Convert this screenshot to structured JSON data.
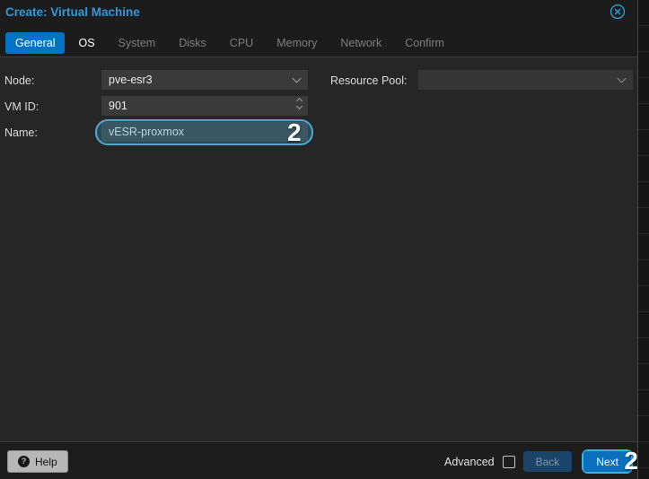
{
  "window": {
    "title": "Create: Virtual Machine"
  },
  "tabs": {
    "items": [
      {
        "label": "General",
        "state": "active"
      },
      {
        "label": "OS",
        "state": "enabled"
      },
      {
        "label": "System",
        "state": "disabled"
      },
      {
        "label": "Disks",
        "state": "disabled"
      },
      {
        "label": "CPU",
        "state": "disabled"
      },
      {
        "label": "Memory",
        "state": "disabled"
      },
      {
        "label": "Network",
        "state": "disabled"
      },
      {
        "label": "Confirm",
        "state": "disabled"
      }
    ]
  },
  "form": {
    "node": {
      "label": "Node:",
      "value": "pve-esr3",
      "control": "dropdown"
    },
    "vmid": {
      "label": "VM ID:",
      "value": "901",
      "control": "spinner"
    },
    "name": {
      "label": "Name:",
      "value": "vESR-proxmox",
      "control": "text-input"
    },
    "resource_pool": {
      "label": "Resource Pool:",
      "value": "",
      "control": "dropdown"
    }
  },
  "footer": {
    "help_label": "Help",
    "help_icon_glyph": "?",
    "advanced_label": "Advanced",
    "advanced_checked": false,
    "back_label": "Back",
    "next_label": "Next"
  },
  "annotations": {
    "marks": [
      {
        "id": "2",
        "target": "name-input"
      },
      {
        "id": "2",
        "target": "next-button"
      }
    ]
  },
  "colors": {
    "title_blue": "#3598d6",
    "active_tab_blue": "#0173c4",
    "next_button_blue": "#0a6fbc",
    "back_button_blue": "#1a4469",
    "annotation_cyan": "#4fa8cb",
    "panel_bg": "#262626",
    "field_bg": "#3a3a3a",
    "footer_bg": "#1d1d1d"
  }
}
